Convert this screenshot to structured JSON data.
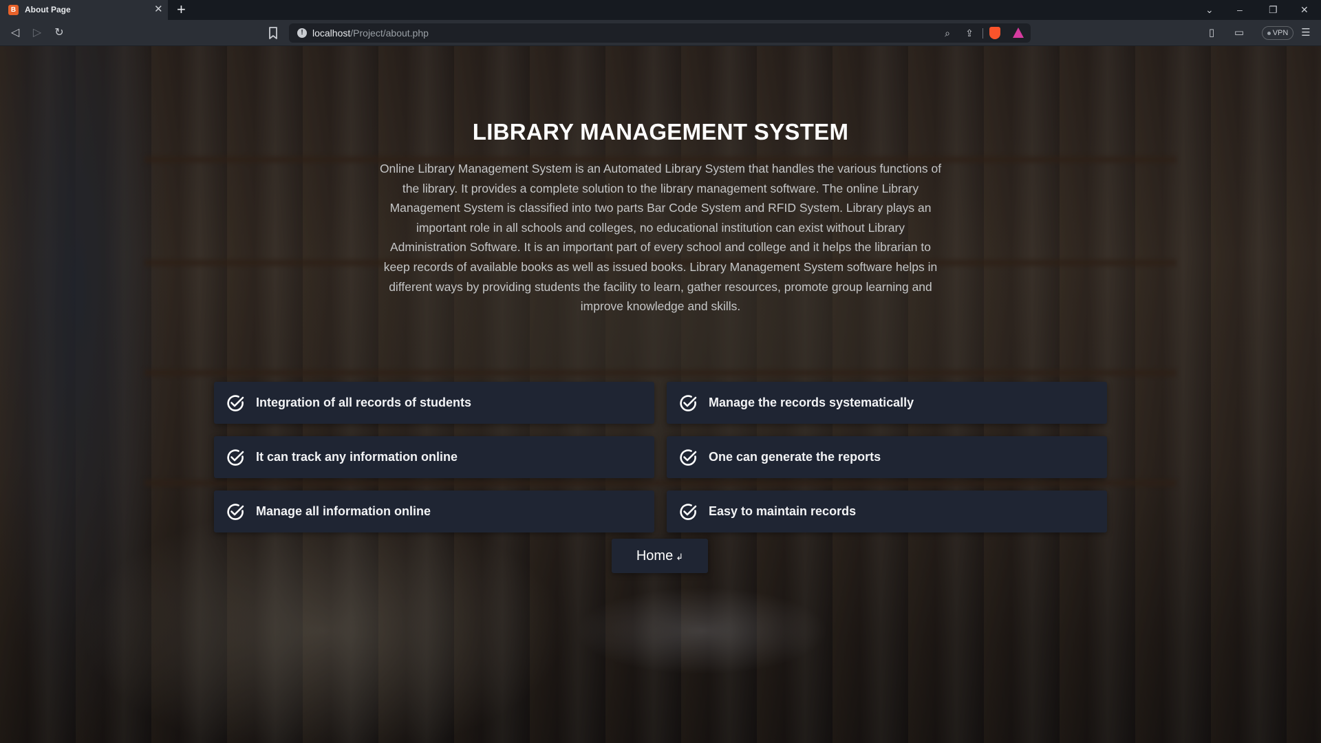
{
  "browser": {
    "tab_title": "About Page",
    "tab_favicon": "brave-favicon",
    "url_host": "localhost",
    "url_path": "/Project/about.php",
    "vpn_label": "VPN"
  },
  "page": {
    "heading": "LIBRARY MANAGEMENT SYSTEM",
    "intro": "Online Library Management System is an Automated Library System that handles the various functions of the library. It provides a complete solution to the library management software. The online Library Management System is classified into two parts Bar Code System and RFID System. Library plays an important role in all schools and colleges, no educational institution can exist without Library Administration Software. It is an important part of every school and college and it helps the librarian to keep records of available books as well as issued books. Library Management System software helps in different ways by providing students the facility to learn, gather resources, promote group learning and improve knowledge and skills.",
    "features": [
      "Integration of all records of students",
      "Manage the records systematically",
      "It can track any information online",
      "One can generate the reports",
      "Manage all information online",
      "Easy to maintain records"
    ],
    "home_button": "Home",
    "home_button_icon": "return-arrow-icon"
  },
  "colors": {
    "card_bg": "#1f2533",
    "heading": "#ffffff",
    "intro_text": "#c5c6c7"
  }
}
